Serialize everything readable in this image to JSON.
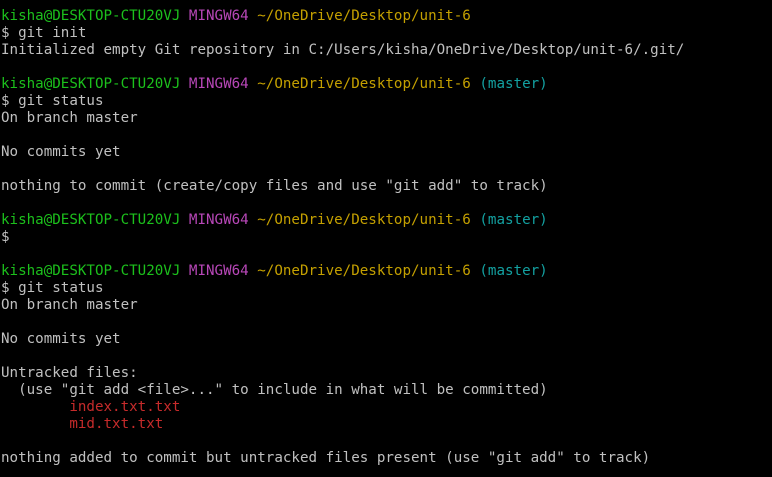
{
  "prompt": {
    "user_host": "kisha@DESKTOP-CTU20VJ",
    "system": "MINGW64",
    "path": "~/OneDrive/Desktop/unit-6",
    "branch": "(master)",
    "symbol": "$"
  },
  "blocks": [
    {
      "show_branch": false,
      "command": "git init",
      "output": [
        {
          "text": "Initialized empty Git repository in C:/Users/kisha/OneDrive/Desktop/unit-6/.git/",
          "kind": "normal"
        },
        {
          "text": "",
          "kind": "normal"
        }
      ]
    },
    {
      "show_branch": true,
      "command": "git status",
      "output": [
        {
          "text": "On branch master",
          "kind": "normal"
        },
        {
          "text": "",
          "kind": "normal"
        },
        {
          "text": "No commits yet",
          "kind": "normal"
        },
        {
          "text": "",
          "kind": "normal"
        },
        {
          "text": "nothing to commit (create/copy files and use \"git add\" to track)",
          "kind": "normal"
        },
        {
          "text": "",
          "kind": "normal"
        }
      ]
    },
    {
      "show_branch": true,
      "command": "",
      "output": [
        {
          "text": "",
          "kind": "normal"
        }
      ]
    },
    {
      "show_branch": true,
      "command": "git status",
      "output": [
        {
          "text": "On branch master",
          "kind": "normal"
        },
        {
          "text": "",
          "kind": "normal"
        },
        {
          "text": "No commits yet",
          "kind": "normal"
        },
        {
          "text": "",
          "kind": "normal"
        },
        {
          "text": "Untracked files:",
          "kind": "normal"
        },
        {
          "text": "  (use \"git add <file>...\" to include in what will be committed)",
          "kind": "normal"
        },
        {
          "text": "        index.txt.txt",
          "kind": "untracked"
        },
        {
          "text": "        mid.txt.txt",
          "kind": "untracked"
        },
        {
          "text": "",
          "kind": "normal"
        },
        {
          "text": "nothing added to commit but untracked files present (use \"git add\" to track)",
          "kind": "normal"
        }
      ]
    }
  ],
  "colors": {
    "background": "#000000",
    "text": "#c0c0c0",
    "user_host": "#1cc01c",
    "system": "#b847b8",
    "path": "#c4a000",
    "branch": "#13a1a1",
    "untracked": "#c62b2b"
  }
}
